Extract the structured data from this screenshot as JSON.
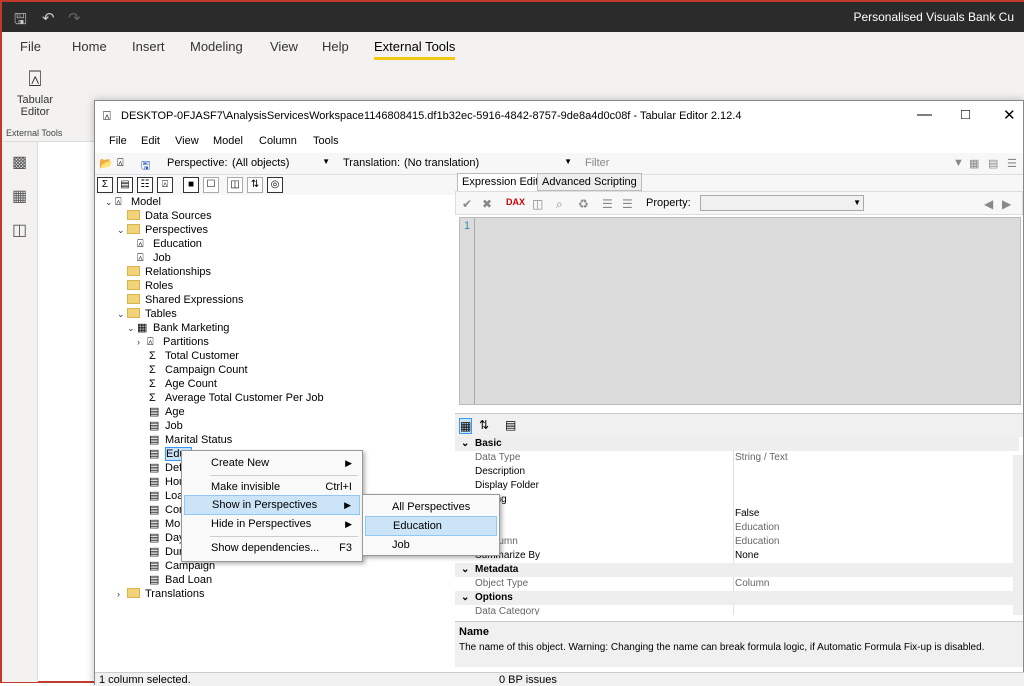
{
  "pbi": {
    "window_title": "Personalised Visuals Bank Cu",
    "ribbon_tabs": [
      "File",
      "Home",
      "Insert",
      "Modeling",
      "View",
      "Help",
      "External Tools"
    ],
    "active_tab": "External Tools",
    "tool_label": "Tabular Editor",
    "group_label": "External Tools"
  },
  "te": {
    "title": "DESKTOP-0FJASF7\\AnalysisServicesWorkspace1146808415.df1b32ec-5916-4842-8757-9de8a4d0c08f - Tabular Editor 2.12.4",
    "menu": [
      "File",
      "Edit",
      "View",
      "Model",
      "Column",
      "Tools"
    ],
    "perspective_label": "Perspective:",
    "perspective_value": "(All objects)",
    "translation_label": "Translation:",
    "translation_value": "(No translation)",
    "filter_placeholder": "Filter",
    "tree": [
      "Model",
      "Data Sources",
      "Perspectives",
      "Education",
      "Job",
      "Relationships",
      "Roles",
      "Shared Expressions",
      "Tables",
      "Bank Marketing",
      "Partitions",
      "Total Customer",
      "Campaign Count",
      "Age Count",
      "Average Total Customer Per Job",
      "Age",
      "Job",
      "Marital Status",
      "Educ",
      "Def",
      "Hou",
      "Loa",
      "Con",
      "Mor",
      "Day",
      "Dur",
      "Campaign",
      "Bad Loan",
      "Translations"
    ],
    "right_tabs": [
      "Expression Editor",
      "Advanced Scripting"
    ],
    "property_label": "Property:",
    "line_number": "1",
    "props": [
      {
        "k": "Basic",
        "cat": true
      },
      {
        "k": "Data Type",
        "v": "String / Text"
      },
      {
        "k": "Description",
        "v": ""
      },
      {
        "k": "Display Folder",
        "v": ""
      },
      {
        "k": "t String",
        "v": ""
      },
      {
        "k": "n",
        "v": "False"
      },
      {
        "k": "",
        "v": "Education"
      },
      {
        "k": "e Column",
        "v": "Education"
      },
      {
        "k": "Summarize By",
        "v": "None"
      },
      {
        "k": "Metadata",
        "cat": true
      },
      {
        "k": "Object Type",
        "v": "Column"
      },
      {
        "k": "Options",
        "cat": true
      },
      {
        "k": "Data Category",
        "v": ""
      }
    ],
    "desc_name": "Name",
    "desc_text": "The name of this object. Warning: Changing the name can break formula logic, if Automatic Formula Fix-up is disabled.",
    "status_left": "1 column selected.",
    "status_mid": "0 BP issues"
  },
  "context_menu": {
    "items": [
      {
        "label": "Create New",
        "shortcut": "",
        "arrow": true
      },
      {
        "label": "Make invisible",
        "shortcut": "Ctrl+I",
        "arrow": false
      },
      {
        "label": "Show in Perspectives",
        "shortcut": "",
        "arrow": true
      },
      {
        "label": "Hide in Perspectives",
        "shortcut": "",
        "arrow": true
      },
      {
        "label": "Show dependencies...",
        "shortcut": "F3",
        "arrow": false
      }
    ],
    "submenu": [
      "All Perspectives",
      "Education",
      "Job"
    ]
  }
}
